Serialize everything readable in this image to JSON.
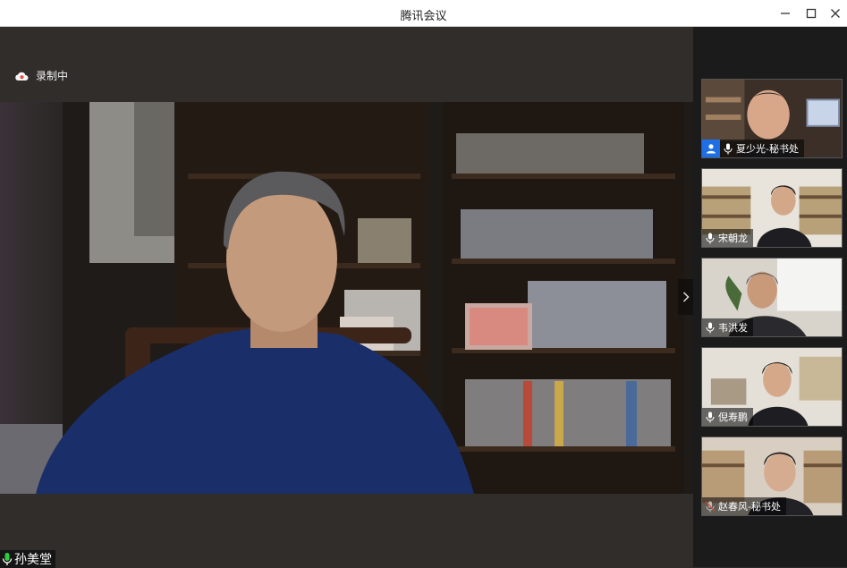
{
  "app": {
    "title": "腾讯会议"
  },
  "window_controls": {
    "minimize": "minimize-icon",
    "maximize": "maximize-icon",
    "close": "close-icon"
  },
  "recording": {
    "label": "录制中",
    "icon": "cloud-recording-icon",
    "icon_color": "#e0524a"
  },
  "main_speaker": {
    "name": "孙美堂",
    "mic_icon": "microphone-icon",
    "mic_color": "#2ecc40"
  },
  "sidebar": {
    "participants": [
      {
        "name": "夏少光-秘书处",
        "icon": "microphone-icon"
      },
      {
        "name": "宋朝龙",
        "icon": "microphone-icon"
      },
      {
        "name": "韦洪发",
        "icon": "microphone-icon"
      },
      {
        "name": "倪寿鹏",
        "icon": "microphone-icon"
      },
      {
        "name": "赵春风-秘书处",
        "icon": "microphone-off-icon"
      }
    ]
  },
  "colors": {
    "accent": "#1e6fe6",
    "background": "#2e2d2b"
  }
}
